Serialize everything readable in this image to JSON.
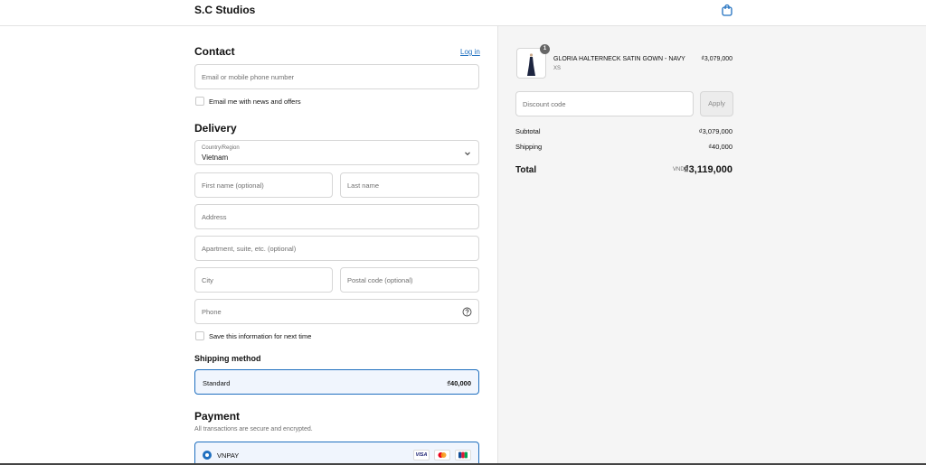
{
  "header": {
    "brand": "S.C Studios",
    "cart_icon": "shopping-bag-icon"
  },
  "contact": {
    "title": "Contact",
    "login_label": "Log in",
    "email_placeholder": "Email or mobile phone number",
    "news_label": "Email me with news and offers"
  },
  "delivery": {
    "title": "Delivery",
    "country_label": "Country/Region",
    "country_value": "Vietnam",
    "first_name_placeholder": "First name (optional)",
    "last_name_placeholder": "Last name",
    "address_placeholder": "Address",
    "apartment_placeholder": "Apartment, suite, etc. (optional)",
    "city_placeholder": "City",
    "postal_placeholder": "Postal code (optional)",
    "phone_placeholder": "Phone",
    "save_label": "Save this information for next time"
  },
  "shipping": {
    "title": "Shipping method",
    "option_name": "Standard",
    "option_price": "₫40,000"
  },
  "payment": {
    "title": "Payment",
    "note": "All transactions are secure and encrypted.",
    "method": "VNPAY",
    "cards": [
      "VISA",
      "mastercard",
      "JCB"
    ]
  },
  "order": {
    "quantity": "1",
    "product_name": "GLORIA HALTERNECK SATIN GOWN - NAVY",
    "product_variant": "XS",
    "product_price": "₫3,079,000",
    "discount_placeholder": "Discount code",
    "apply_label": "Apply",
    "subtotal_label": "Subtotal",
    "subtotal_value": "₫3,079,000",
    "shipping_label": "Shipping",
    "shipping_value": "₫40,000",
    "total_label": "Total",
    "total_currency": "VND",
    "total_value": "₫3,119,000"
  },
  "colors": {
    "accent": "#1f6fbf",
    "panel_bg": "#f5f5f5"
  }
}
